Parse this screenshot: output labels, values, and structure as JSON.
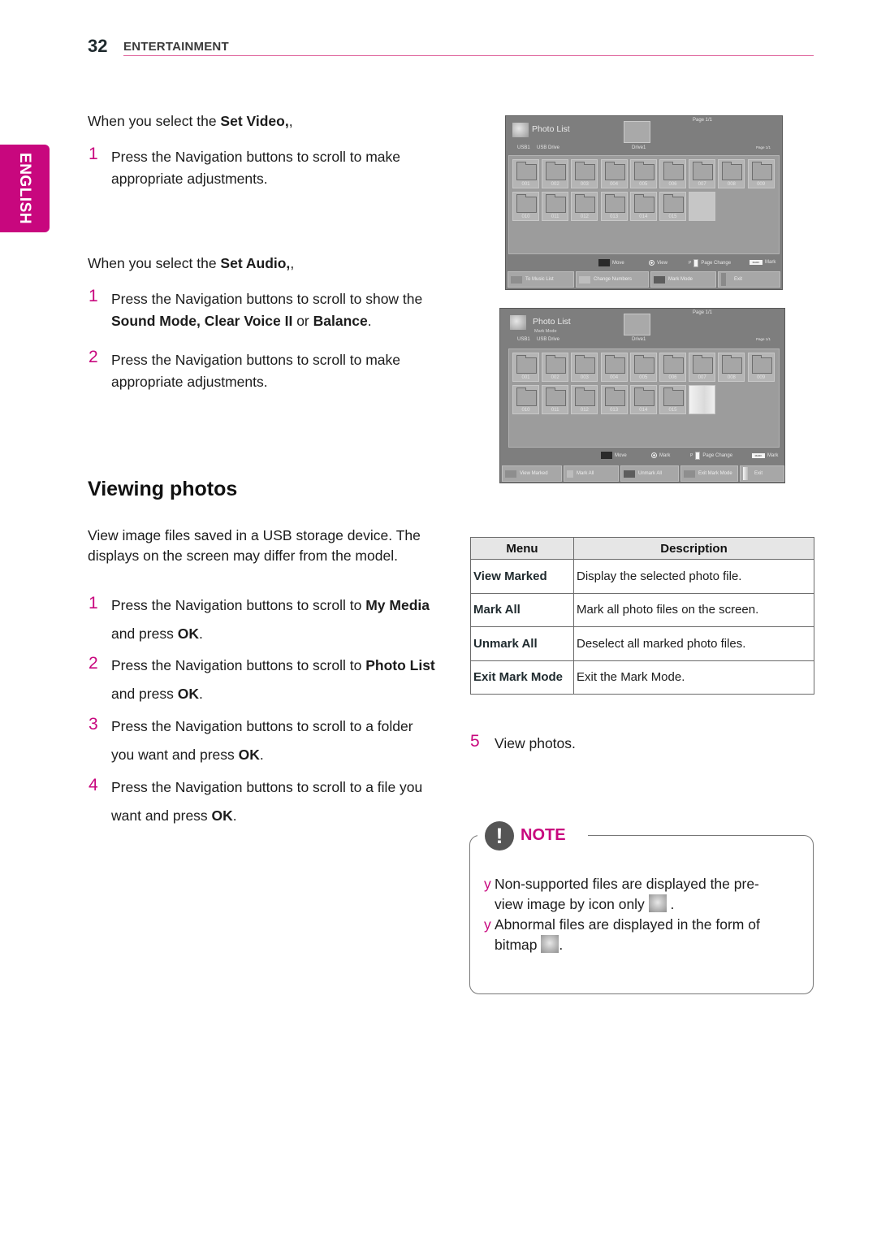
{
  "header": {
    "page_number": "32",
    "section": "ENTERTAINMENT"
  },
  "side_tab": {
    "language": "ENGLISH"
  },
  "set_video": {
    "intro_pre": "When you select the ",
    "intro_bold": "Set Video,",
    "intro_post": ",",
    "steps": [
      {
        "num": "1",
        "text": "Press the Navigation buttons to scroll to make appropriate adjustments."
      }
    ]
  },
  "set_audio": {
    "intro_pre": "When you select the ",
    "intro_bold": "Set Audio,",
    "intro_post": ",",
    "steps": [
      {
        "num": "1",
        "t1": "Press the Navigation buttons to scroll to show the ",
        "b1": "Sound Mode, Clear Voice II",
        "t2": " or ",
        "b2": "Balance",
        "t3": "."
      },
      {
        "num": "2",
        "text": "Press the Navigation buttons to scroll to make appropriate adjustments."
      }
    ]
  },
  "viewing_photos": {
    "heading": "Viewing photos",
    "intro": "View image files saved in a USB storage device. The displays on the screen may differ from the model.",
    "steps": [
      {
        "num": "1",
        "t1": "Press the Navigation buttons to scroll to ",
        "b1": "My Media",
        "t2": " and press ",
        "b2": "OK",
        "t3": "."
      },
      {
        "num": "2",
        "t1": "Press the Navigation buttons to scroll to ",
        "b1": "Photo List",
        "t2": " and press ",
        "b2": "OK",
        "t3": "."
      },
      {
        "num": "3",
        "t1": "Press the Navigation buttons to scroll to a folder you want and press ",
        "b1": "OK",
        "t2": "."
      },
      {
        "num": "4",
        "t1": "Press the Navigation buttons to scroll to a file you want and press ",
        "b1": "OK",
        "t2": "."
      },
      {
        "num": "5",
        "text": "View photos."
      }
    ]
  },
  "tv_screen_1": {
    "title": "Photo List",
    "mode": "",
    "page_top": "Page 1/1",
    "page_right": "Page 1/1",
    "usb": "USB1",
    "drive_label": "USB Drive",
    "folder": "Drive1",
    "tiles": [
      "001",
      "002",
      "003",
      "004",
      "005",
      "006",
      "007",
      "008",
      "009",
      "010",
      "011",
      "012",
      "013",
      "014",
      "015"
    ],
    "legend": {
      "move": "Move",
      "ok": "View",
      "page": "Page Change",
      "mark_key": "MARK",
      "mark": "Mark",
      "p_key": "P"
    },
    "buttons": [
      {
        "label": "To Music List",
        "color": "#8e8e8e"
      },
      {
        "label": "Change Numbers",
        "color": "#bdbdbd"
      },
      {
        "label": "Mark Mode",
        "color": "#5d5d5d"
      },
      {
        "label": "Exit",
        "color": "#8a8a8a"
      }
    ]
  },
  "tv_screen_2": {
    "title": "Photo List",
    "mode": "Mark Mode",
    "page_top": "Page 1/1",
    "page_right": "Page 1/1",
    "usb": "USB1",
    "drive_label": "USB Drive",
    "folder": "Drive1",
    "tiles": [
      "001",
      "002",
      "003",
      "004",
      "005",
      "006",
      "007",
      "008",
      "009",
      "010",
      "011",
      "012",
      "013",
      "014",
      "015"
    ],
    "legend": {
      "move": "Move",
      "ok": "Mark",
      "page": "Page Change",
      "mark_key": "MARK",
      "mark": "Mark",
      "p_key": "P"
    },
    "buttons": [
      {
        "label": "View Marked",
        "color": "#8e8e8e"
      },
      {
        "label": "Mark All",
        "color": "#bdbdbd"
      },
      {
        "label": "Unmark All",
        "color": "#5d5d5d"
      },
      {
        "label": "Exit Mark Mode",
        "color": "#8e8e8e"
      },
      {
        "label": "Exit",
        "color": "#e8e8e8"
      }
    ]
  },
  "menu_table": {
    "headers": [
      "Menu",
      "Description"
    ],
    "rows": [
      {
        "menu": "View Marked",
        "description": "Display the selected photo file."
      },
      {
        "menu": "Mark All",
        "description": "Mark all photo files on the screen."
      },
      {
        "menu": "Unmark All",
        "description": "Deselect all marked photo files."
      },
      {
        "menu": "Exit Mark Mode",
        "description": "Exit the Mark Mode."
      }
    ]
  },
  "note": {
    "icon": "!",
    "title": "NOTE",
    "bullet_glyph": "y",
    "items": [
      {
        "line1": "Non-supported files are displayed the pre-",
        "line2": "view image by icon only",
        "post": " ."
      },
      {
        "line1": "Abnormal files are displayed in the form of",
        "line2": "bitmap",
        "post": "."
      }
    ]
  },
  "colors": {
    "accent": "#c8077e",
    "header_rule": "#e0679e",
    "tv_bg": "#7e7e7e"
  }
}
